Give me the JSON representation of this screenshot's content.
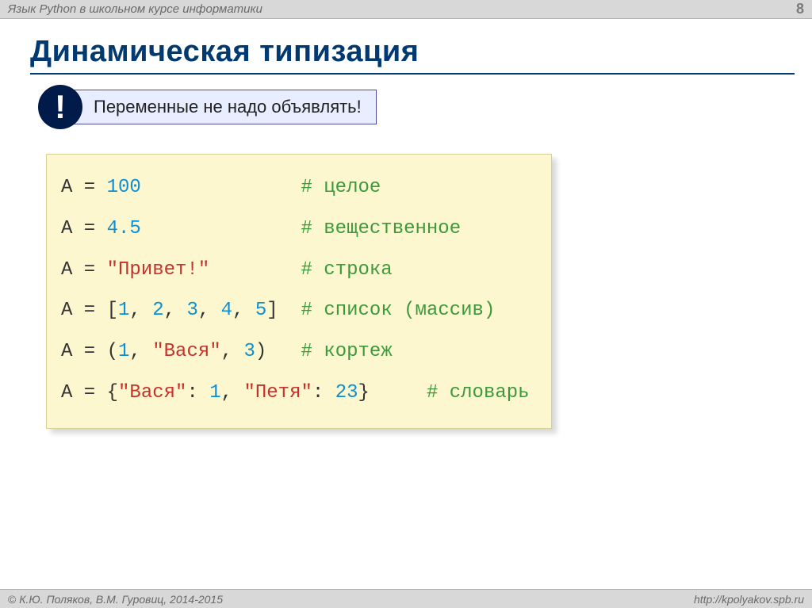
{
  "header": {
    "course_title": "Язык Python в школьном курсе информатики",
    "page_number": "8"
  },
  "title": "Динамическая типизация",
  "callout": {
    "badge": "!",
    "text": "Переменные не надо объявлять!"
  },
  "code": {
    "l1": {
      "lhs": "A = ",
      "val": "100",
      "pad": "              ",
      "cmt": "# целое"
    },
    "l2": {
      "lhs": "A = ",
      "val": "4.5",
      "pad": "              ",
      "cmt": "# вещественное"
    },
    "l3": {
      "lhs": "A = ",
      "val": "\"Привет!\"",
      "pad": "        ",
      "cmt": "# строка"
    },
    "l4": {
      "lhs": "A = [",
      "n1": "1",
      "c1": ", ",
      "n2": "2",
      "c2": ", ",
      "n3": "3",
      "c3": ", ",
      "n4": "4",
      "c4": ", ",
      "n5": "5",
      "close": "]  ",
      "cmt": "# список (массив)"
    },
    "l5": {
      "lhs": "A = (",
      "n1": "1",
      "c1": ", ",
      "s1": "\"Вася\"",
      "c2": ", ",
      "n2": "3",
      "close": ")   ",
      "cmt": "# кортеж"
    },
    "l6": {
      "lhs": "A = {",
      "k1": "\"Вася\"",
      "c1": ": ",
      "v1": "1",
      "c2": ", ",
      "k2": "\"Петя\"",
      "c3": ": ",
      "v2": "23",
      "close": "}     ",
      "cmt": "# словарь"
    }
  },
  "footer": {
    "authors": "К.Ю. Поляков, В.М. Гуровиц, 2014-2015",
    "url": "http://kpolyakov.spb.ru"
  }
}
